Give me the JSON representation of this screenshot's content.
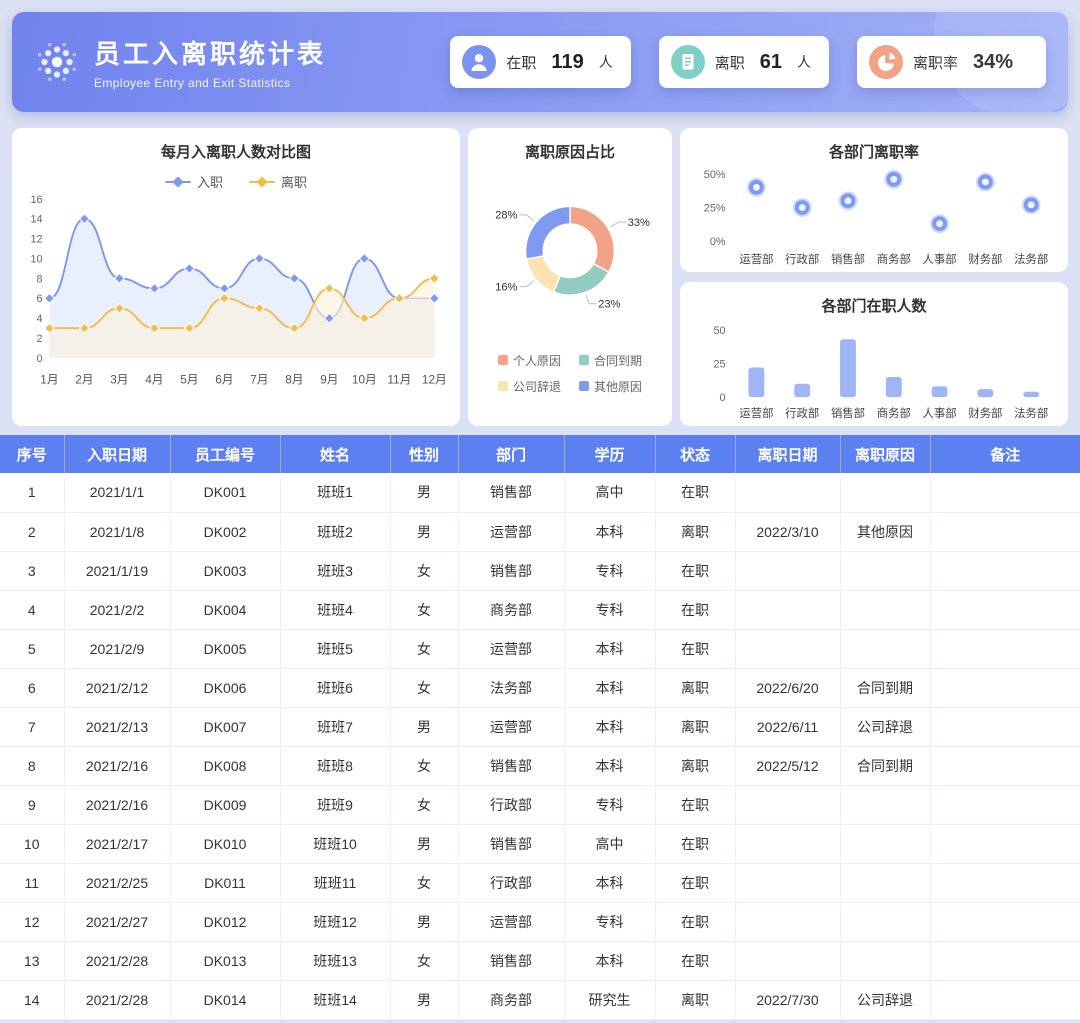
{
  "app": {
    "title": "员工入离职统计表",
    "subtitle": "Employee Entry and Exit Statistics"
  },
  "stats": [
    {
      "label": "在职",
      "value": "119",
      "unit": "人",
      "icon": "employee-icon",
      "color": "#7b93f0"
    },
    {
      "label": "离职",
      "value": "61",
      "unit": "人",
      "icon": "document-icon",
      "color": "#7ecfc5"
    },
    {
      "label": "离职率",
      "value": "34%",
      "unit": "",
      "icon": "pie-icon",
      "color": "#f2a287"
    }
  ],
  "chart_data": [
    {
      "type": "line",
      "title": "每月入离职人数对比图",
      "categories": [
        "1月",
        "2月",
        "3月",
        "4月",
        "5月",
        "6月",
        "7月",
        "8月",
        "9月",
        "10月",
        "11月",
        "12月"
      ],
      "series": [
        {
          "name": "入职",
          "color": "#7d9af0",
          "fill": "#dde7fa",
          "values": [
            6,
            14,
            8,
            7,
            9,
            7,
            10,
            8,
            4,
            10,
            6,
            6
          ]
        },
        {
          "name": "离职",
          "color": "#f3bc4e",
          "fill": "#fdf1dd",
          "values": [
            3,
            3,
            5,
            3,
            3,
            6,
            5,
            3,
            7,
            4,
            6,
            8
          ]
        }
      ],
      "ylim": [
        0,
        16
      ],
      "yticks": [
        0,
        2,
        4,
        6,
        8,
        10,
        12,
        14,
        16
      ],
      "legend_position": "top"
    },
    {
      "type": "pie",
      "title": "离职原因占比",
      "slices": [
        {
          "label": "个人原因",
          "value": 33,
          "color": "#f2a287"
        },
        {
          "label": "合同到期",
          "value": 23,
          "color": "#93ccc3"
        },
        {
          "label": "公司辞退",
          "value": 16,
          "color": "#fae3ae"
        },
        {
          "label": "其他原因",
          "value": 28,
          "color": "#7d9af0"
        }
      ],
      "legend_position": "bottom"
    },
    {
      "type": "scatter",
      "title": "各部门离职率",
      "categories": [
        "运营部",
        "行政部",
        "销售部",
        "商务部",
        "人事部",
        "财务部",
        "法务部"
      ],
      "values": [
        40,
        25,
        30,
        46,
        13,
        44,
        27
      ],
      "yticks": [
        "50%",
        "25%",
        "0%"
      ],
      "ylim": [
        0,
        50
      ],
      "color": "#7d9af0"
    },
    {
      "type": "bar",
      "title": "各部门在职人数",
      "categories": [
        "运营部",
        "行政部",
        "销售部",
        "商务部",
        "人事部",
        "财务部",
        "法务部"
      ],
      "values": [
        22,
        10,
        43,
        15,
        8,
        6,
        4
      ],
      "yticks": [
        50,
        25,
        0
      ],
      "ylim": [
        0,
        50
      ],
      "color": "#9fb5f4"
    }
  ],
  "table": {
    "headers": [
      "序号",
      "入职日期",
      "员工编号",
      "姓名",
      "性别",
      "部门",
      "学历",
      "状态",
      "离职日期",
      "离职原因",
      "备注"
    ],
    "rows": [
      [
        "1",
        "2021/1/1",
        "DK001",
        "班班1",
        "男",
        "销售部",
        "高中",
        "在职",
        "",
        "",
        ""
      ],
      [
        "2",
        "2021/1/8",
        "DK002",
        "班班2",
        "男",
        "运营部",
        "本科",
        "离职",
        "2022/3/10",
        "其他原因",
        ""
      ],
      [
        "3",
        "2021/1/19",
        "DK003",
        "班班3",
        "女",
        "销售部",
        "专科",
        "在职",
        "",
        "",
        ""
      ],
      [
        "4",
        "2021/2/2",
        "DK004",
        "班班4",
        "女",
        "商务部",
        "专科",
        "在职",
        "",
        "",
        ""
      ],
      [
        "5",
        "2021/2/9",
        "DK005",
        "班班5",
        "女",
        "运营部",
        "本科",
        "在职",
        "",
        "",
        ""
      ],
      [
        "6",
        "2021/2/12",
        "DK006",
        "班班6",
        "女",
        "法务部",
        "本科",
        "离职",
        "2022/6/20",
        "合同到期",
        ""
      ],
      [
        "7",
        "2021/2/13",
        "DK007",
        "班班7",
        "男",
        "运营部",
        "本科",
        "离职",
        "2022/6/11",
        "公司辞退",
        ""
      ],
      [
        "8",
        "2021/2/16",
        "DK008",
        "班班8",
        "女",
        "销售部",
        "本科",
        "离职",
        "2022/5/12",
        "合同到期",
        ""
      ],
      [
        "9",
        "2021/2/16",
        "DK009",
        "班班9",
        "女",
        "行政部",
        "专科",
        "在职",
        "",
        "",
        ""
      ],
      [
        "10",
        "2021/2/17",
        "DK010",
        "班班10",
        "男",
        "销售部",
        "高中",
        "在职",
        "",
        "",
        ""
      ],
      [
        "11",
        "2021/2/25",
        "DK011",
        "班班11",
        "女",
        "行政部",
        "本科",
        "在职",
        "",
        "",
        ""
      ],
      [
        "12",
        "2021/2/27",
        "DK012",
        "班班12",
        "男",
        "运营部",
        "专科",
        "在职",
        "",
        "",
        ""
      ],
      [
        "13",
        "2021/2/28",
        "DK013",
        "班班13",
        "女",
        "销售部",
        "本科",
        "在职",
        "",
        "",
        ""
      ],
      [
        "14",
        "2021/2/28",
        "DK014",
        "班班14",
        "男",
        "商务部",
        "研究生",
        "离职",
        "2022/7/30",
        "公司辞退",
        ""
      ]
    ]
  }
}
